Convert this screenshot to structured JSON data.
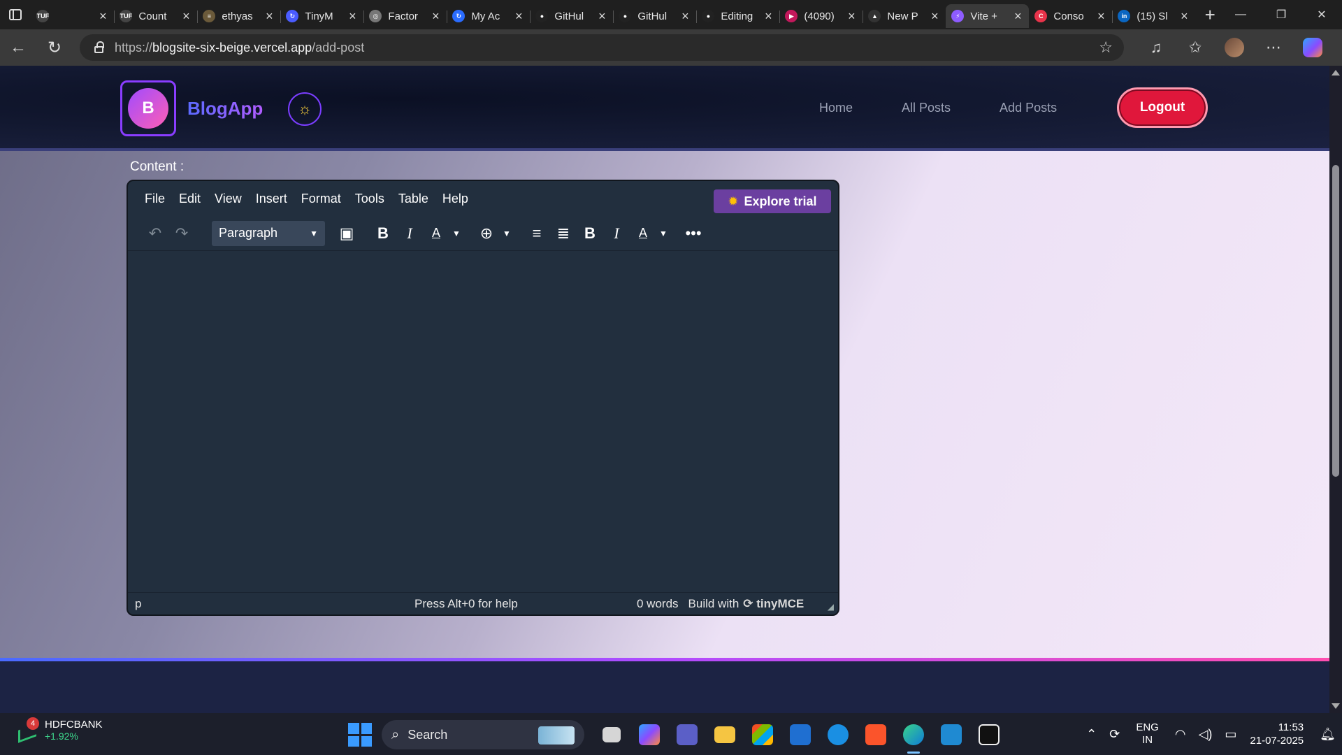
{
  "browser": {
    "tabs": [
      {
        "title": "",
        "color": "#444",
        "glyph": "TUF"
      },
      {
        "title": "Count",
        "color": "#444",
        "glyph": "TUF"
      },
      {
        "title": "ethyas",
        "color": "#6b5a3a",
        "glyph": "≡"
      },
      {
        "title": "TinyM",
        "color": "#4a5cff",
        "glyph": "↻"
      },
      {
        "title": "Factor",
        "color": "#777",
        "glyph": "◎"
      },
      {
        "title": "My Ac",
        "color": "#2a6cff",
        "glyph": "↻"
      },
      {
        "title": "GitHul",
        "color": "#222",
        "glyph": "●"
      },
      {
        "title": "GitHul",
        "color": "#222",
        "glyph": "●"
      },
      {
        "title": "Editing",
        "color": "#222",
        "glyph": "●"
      },
      {
        "title": "(4090)",
        "color": "#c2185b",
        "glyph": "▶"
      },
      {
        "title": "New P",
        "color": "#333",
        "glyph": "▲"
      },
      {
        "title": "Vite +",
        "color": "#8e5cff",
        "glyph": "⚡"
      },
      {
        "title": "Conso",
        "color": "#e8334a",
        "glyph": "C"
      },
      {
        "title": "(15) Sl",
        "color": "#0a66c2",
        "glyph": "in"
      }
    ],
    "active_tab_index": 11,
    "url_prefix": "https://",
    "url_host": "blogsite-six-beige.vercel.app",
    "url_path": "/add-post"
  },
  "site": {
    "logo_letter": "B",
    "brand": "BlogApp",
    "nav": [
      "Home",
      "All Posts",
      "Add Posts"
    ],
    "logout": "Logout"
  },
  "form": {
    "content_label": "Content :"
  },
  "editor": {
    "menu": [
      "File",
      "Edit",
      "View",
      "Insert",
      "Format",
      "Tools",
      "Table",
      "Help"
    ],
    "explore_trial": "Explore trial",
    "block_format": "Paragraph",
    "status_path": "p",
    "status_help": "Press Alt+0 for help",
    "word_count": "0 words",
    "build_with": "Build with",
    "brand": "tinyMCE"
  },
  "taskbar": {
    "stock_name": "HDFCBANK",
    "stock_change": "+1.92%",
    "notification_count": "4",
    "search_placeholder": "Search",
    "language": "ENG",
    "region": "IN",
    "time": "11:53",
    "date": "21-07-2025"
  }
}
